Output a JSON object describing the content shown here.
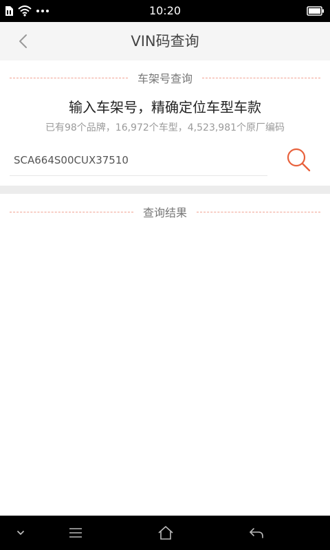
{
  "status_bar": {
    "time": "10:20",
    "icons": [
      "sim-icon",
      "wifi-icon",
      "more-dots-icon",
      "battery-icon"
    ]
  },
  "header": {
    "title": "VIN码查询",
    "back_icon": "chevron-left-icon"
  },
  "vin_section": {
    "title": "车架号查询",
    "headline": "输入车架号，精确定位车型车款",
    "subline": "已有98个品牌，16,972个车型，4,523,981个原厂编码",
    "input_value": "SCA664S00CUX37510",
    "search_icon": "search-icon"
  },
  "results_section": {
    "title": "查询结果"
  },
  "nav_bar": {
    "icons": [
      "chevron-down-icon",
      "menu-icon",
      "home-icon",
      "back-arrow-icon"
    ]
  },
  "colors": {
    "accent": "#e8613c",
    "dash": "#f0a090",
    "header_bg": "#f5f5f5",
    "band": "#ececec"
  }
}
